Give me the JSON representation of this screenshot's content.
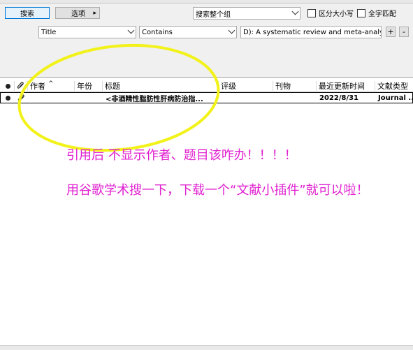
{
  "search_panel": {
    "search_button": "搜索",
    "options_button": "选项",
    "options_arrow": "▸",
    "scope_select": "搜索整个组",
    "match_case_label": "区分大小写",
    "whole_word_label": "全字匹配",
    "field_select": "Title",
    "condition_select": "Contains",
    "query_value": "D): A systematic review and meta-analysis.",
    "add_button": "+",
    "remove_button": "-"
  },
  "table": {
    "headers": [
      "作者",
      "年份",
      "标题",
      "评级",
      "刊物",
      "最近更新时间",
      "文献类型"
    ],
    "sort_indicator": "^",
    "rows": [
      {
        "author": "",
        "year": "",
        "title": "<非酒精性脂肪性肝病防治指...",
        "rating": "",
        "journal": "",
        "updated": "2022/8/31",
        "type": "Journal ..."
      }
    ]
  },
  "annotations": {
    "line1": "引用后 不显示作者、题目该咋办！！！！",
    "line2": "用谷歌学术搜一下，下载一个“文献小插件”就可以啦！"
  },
  "colors": {
    "annotation": "#e020d0",
    "highlight_ellipse": "#f2f21a",
    "accent_border": "#0078d7"
  },
  "icons": [
    "status-dot-icon",
    "attachment-icon",
    "sort-arrow-icon",
    "dropdown-arrow-icon"
  ]
}
